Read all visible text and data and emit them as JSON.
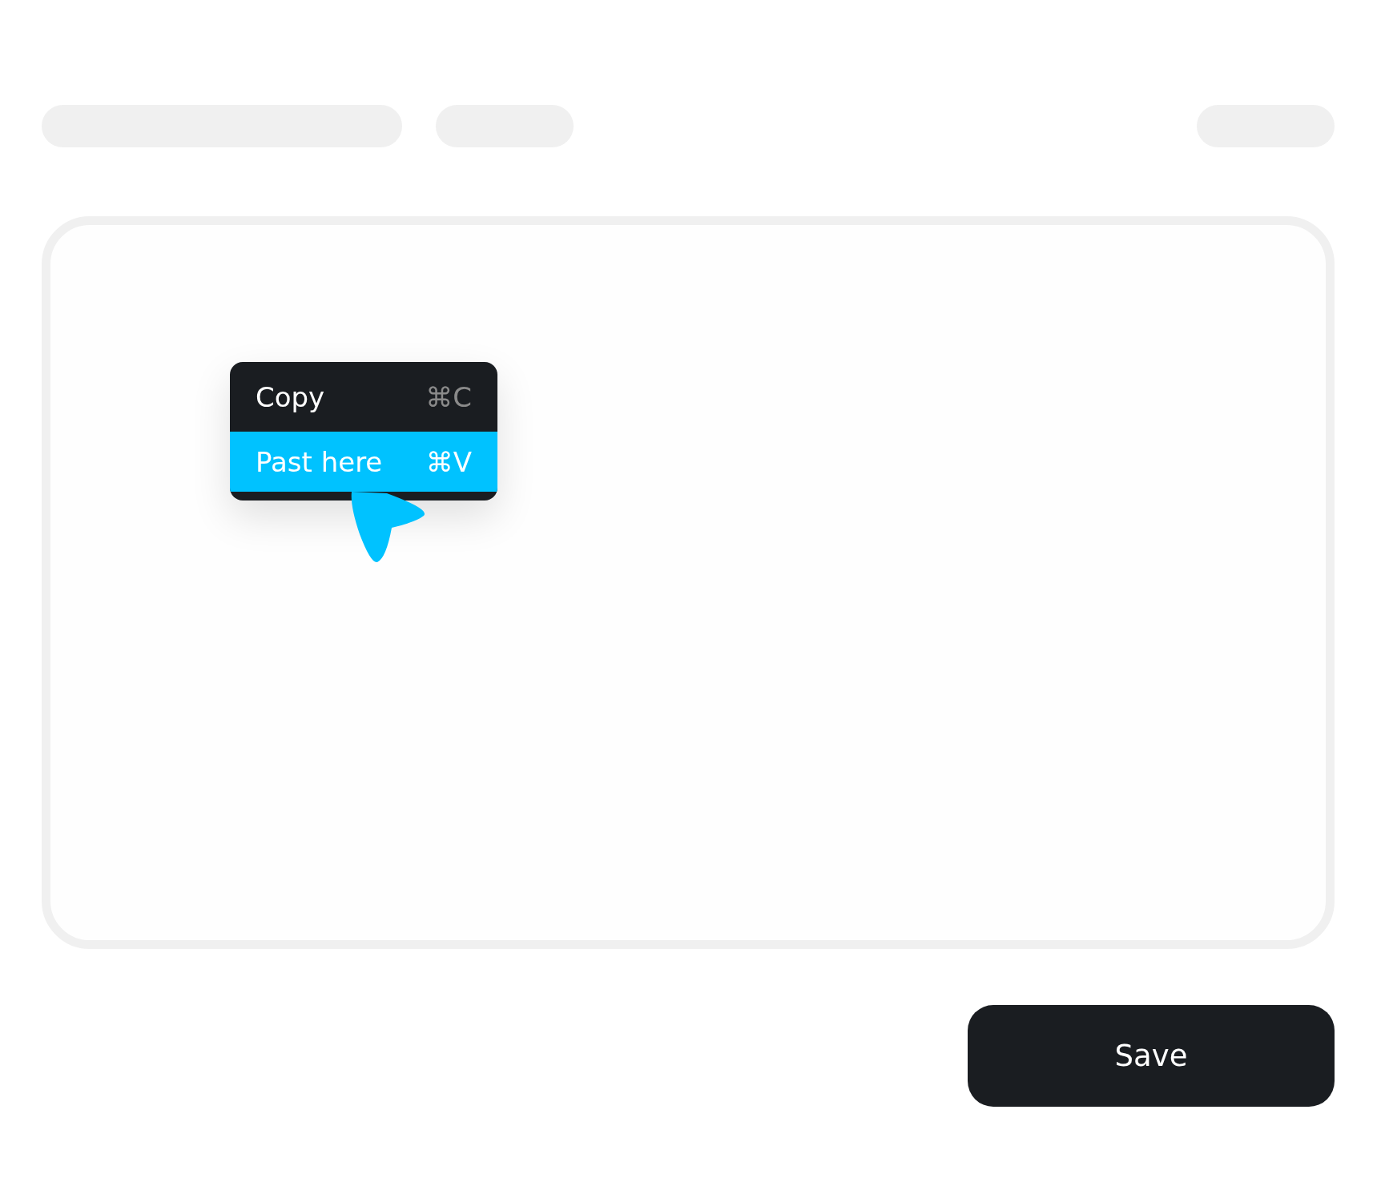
{
  "context_menu": {
    "items": [
      {
        "label": "Copy",
        "shortcut": "⌘C",
        "selected": false
      },
      {
        "label": "Past here",
        "shortcut": "⌘V",
        "selected": true
      }
    ]
  },
  "save_button": {
    "label": "Save"
  }
}
